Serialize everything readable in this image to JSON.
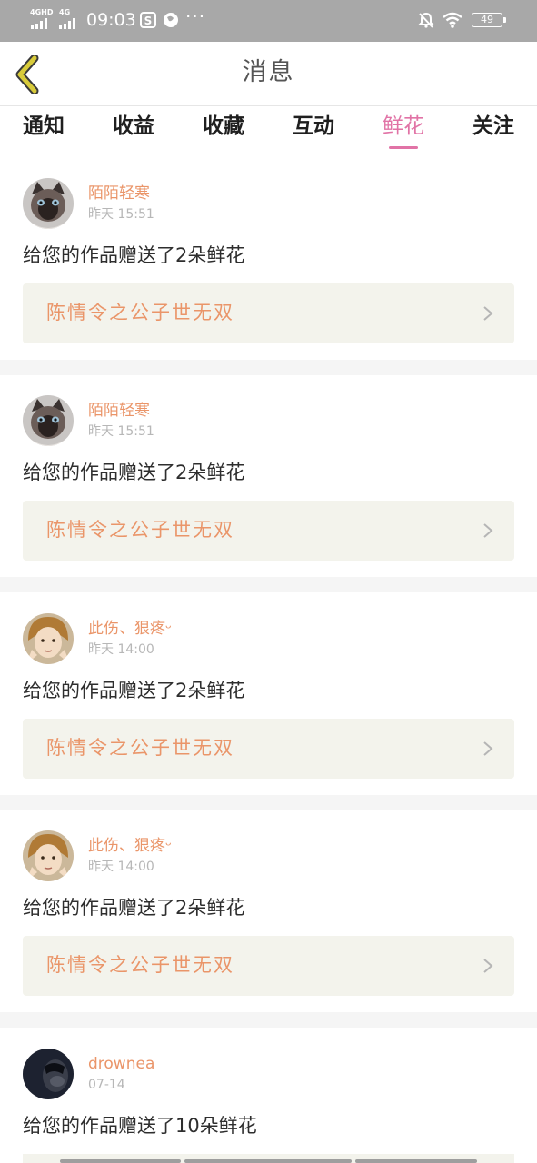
{
  "status_bar": {
    "network1": "4GHD",
    "network2": "4G",
    "time": "09:03",
    "battery": "49"
  },
  "header": {
    "title": "消息"
  },
  "tabs": [
    {
      "label": "通知",
      "active": false
    },
    {
      "label": "收益",
      "active": false
    },
    {
      "label": "收藏",
      "active": false
    },
    {
      "label": "互动",
      "active": false
    },
    {
      "label": "鲜花",
      "active": true
    },
    {
      "label": "关注",
      "active": false
    }
  ],
  "messages": [
    {
      "user": "陌陌轻寒",
      "time": "昨天 15:51",
      "text": "给您的作品赠送了2朵鲜花",
      "work": "陈情令之公子世无双",
      "avatar": "cat-avatar"
    },
    {
      "user": "陌陌轻寒",
      "time": "昨天 15:51",
      "text": "给您的作品赠送了2朵鲜花",
      "work": "陈情令之公子世无双",
      "avatar": "cat-avatar"
    },
    {
      "user": "此伤、狠疼ᵕ",
      "time": "昨天 14:00",
      "text": "给您的作品赠送了2朵鲜花",
      "work": "陈情令之公子世无双",
      "avatar": "person-avatar"
    },
    {
      "user": "此伤、狠疼ᵕ",
      "time": "昨天 14:00",
      "text": "给您的作品赠送了2朵鲜花",
      "work": "陈情令之公子世无双",
      "avatar": "person-avatar"
    },
    {
      "user": "drownea",
      "time": "07-14",
      "text": "给您的作品赠送了10朵鲜花",
      "work": "",
      "avatar": "dark-avatar"
    }
  ],
  "colors": {
    "accent_pink": "#e173a6",
    "orange_text": "#ea9569",
    "status_bar": "#a8a8a8",
    "back_arrow": "#d8cb3a"
  }
}
